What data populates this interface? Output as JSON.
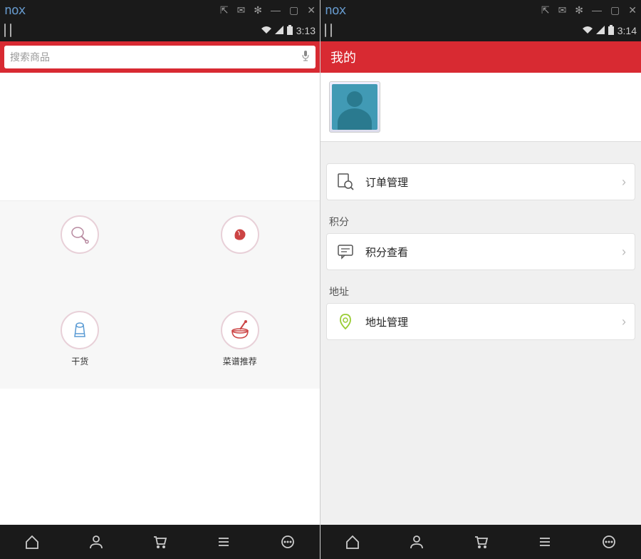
{
  "emulator": {
    "logo": "nox"
  },
  "left": {
    "time": "3:13",
    "search_placeholder": "搜索商品",
    "categories": {
      "dry_goods": "干货",
      "recipe_recommend": "菜谱推荐"
    }
  },
  "right": {
    "time": "3:14",
    "header_title": "我的",
    "menu": {
      "order_management": "订单管理",
      "points_section": "积分",
      "points_query": "积分查看",
      "address_section": "地址",
      "address_management": "地址管理"
    }
  }
}
